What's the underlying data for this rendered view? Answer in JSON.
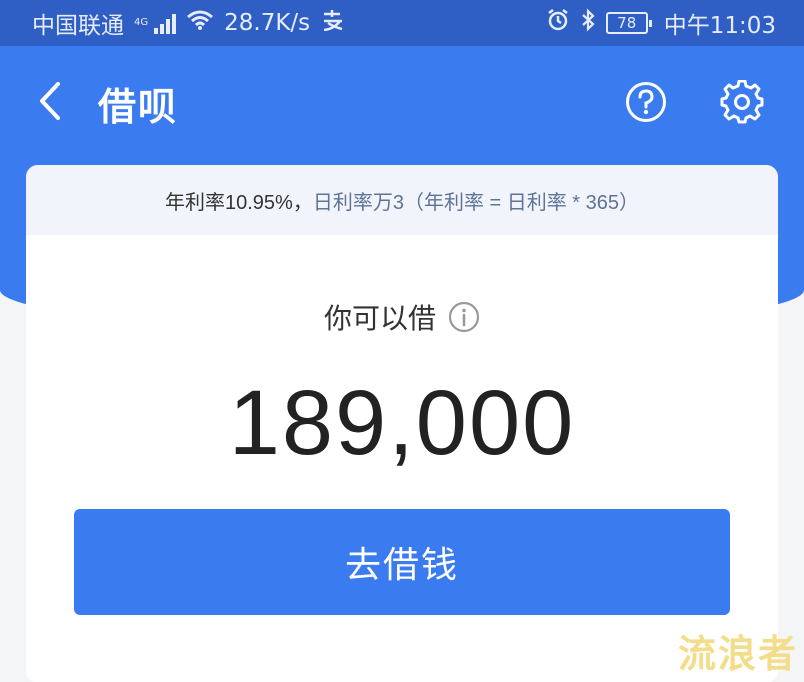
{
  "status_bar": {
    "carrier": "中国联通",
    "network": "4G",
    "speed": "28.7K/s",
    "battery": "78",
    "time": "中午11:03"
  },
  "header": {
    "title": "借呗"
  },
  "card": {
    "rate_prefix": "年利率10.95%，",
    "rate_hint": "日利率万3（年利率 = 日利率 * 365）",
    "label": "你可以借",
    "amount": "189,000",
    "button": "去借钱"
  },
  "watermark": "流浪者",
  "colors": {
    "status_bar": "#2f5fc4",
    "brand_blue": "#3a7cf0",
    "background": "#f4f5f7",
    "rate_bar": "#f1f5fb"
  }
}
